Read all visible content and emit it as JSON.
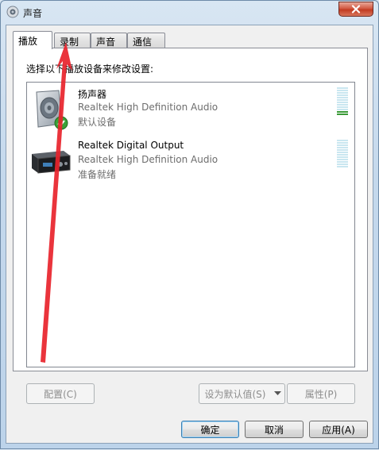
{
  "window": {
    "title": "声音",
    "icon": "speaker-icon",
    "close_icon": "close-icon"
  },
  "tabs": [
    {
      "label": "播放",
      "active": true
    },
    {
      "label": "录制",
      "active": false
    },
    {
      "label": "声音",
      "active": false
    },
    {
      "label": "通信",
      "active": false
    }
  ],
  "panel": {
    "instruction": "选择以下播放设备来修改设置:"
  },
  "devices": [
    {
      "name": "扬声器",
      "driver": "Realtek High Definition Audio",
      "status": "默认设备",
      "icon": "speaker-device-icon",
      "badge_icon": "default-check-icon"
    },
    {
      "name": "Realtek Digital Output",
      "driver": "Realtek High Definition Audio",
      "status": "准备就绪",
      "icon": "digital-output-device-icon"
    }
  ],
  "panel_buttons": {
    "configure": "配置(C)",
    "set_default": "设为默认值(S)",
    "properties": "属性(P)"
  },
  "dialog_buttons": {
    "ok": "确定",
    "cancel": "取消",
    "apply": "应用(A)"
  },
  "colors": {
    "annotation_arrow": "#e8232b",
    "meter_active": "#3b9a38",
    "meter_idle": "#c9e6f0"
  }
}
